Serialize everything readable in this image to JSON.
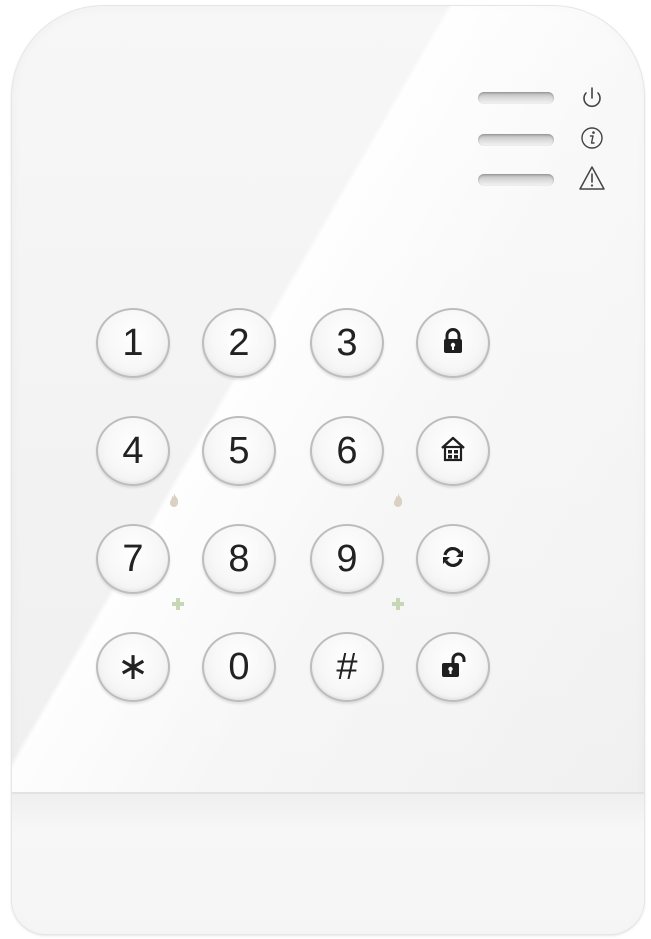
{
  "device": {
    "type": "alarm keypad"
  },
  "status_leds": [
    {
      "icon": "power-icon"
    },
    {
      "icon": "info-icon"
    },
    {
      "icon": "warning-icon"
    }
  ],
  "keypad": {
    "keys": [
      {
        "label": "1"
      },
      {
        "label": "2"
      },
      {
        "label": "3"
      },
      {
        "label": "",
        "icon": "lock-icon"
      },
      {
        "label": "4"
      },
      {
        "label": "5"
      },
      {
        "label": "6"
      },
      {
        "label": "",
        "icon": "home-icon"
      },
      {
        "label": "7"
      },
      {
        "label": "8"
      },
      {
        "label": "9"
      },
      {
        "label": "",
        "icon": "refresh-icon"
      },
      {
        "label": "∗"
      },
      {
        "label": "0"
      },
      {
        "label": "#"
      },
      {
        "label": "",
        "icon": "unlock-icon"
      }
    ]
  },
  "colors": {
    "body": "#f3f3f3",
    "key_border": "#bdbdbd",
    "text": "#222222",
    "hint_green": "#c7d7b5",
    "hint_fire": "#d9d2c0"
  }
}
